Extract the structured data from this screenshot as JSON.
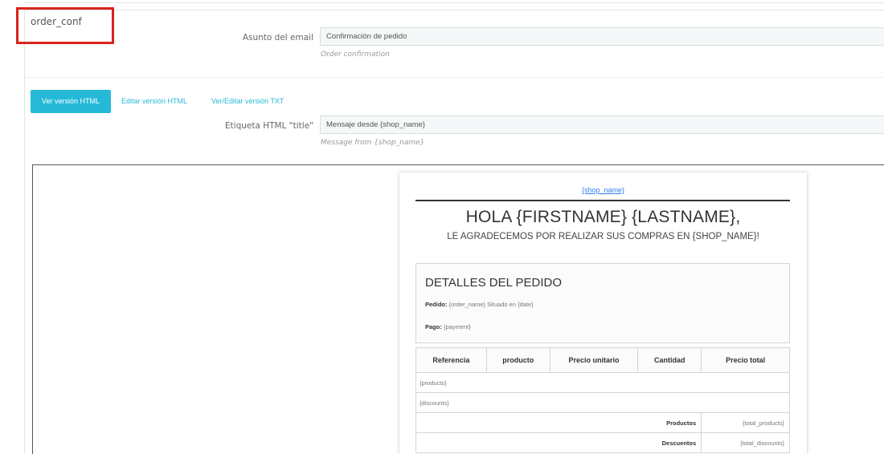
{
  "template": {
    "name": "order_conf"
  },
  "subject": {
    "label": "Asunto del email",
    "value": "Confirmación de pedido",
    "help": "Order confirmation"
  },
  "tabs": [
    {
      "label": "Ver versión HTML",
      "active": true
    },
    {
      "label": "Editar versión HTML",
      "active": false
    },
    {
      "label": "Ver/Editar versión TXT",
      "active": false
    }
  ],
  "title_tag": {
    "label": "Etiqueta HTML \"title\"",
    "value": "Mensaje desde {shop_name}",
    "help": "Message from {shop_name}"
  },
  "mail": {
    "shop_link": "{shop_name}",
    "greeting": "HOLA {FIRSTNAME} {LASTNAME},",
    "subtitle": "LE AGRADECEMOS POR REALIZAR SUS COMPRAS EN {SHOP_NAME}!",
    "details": {
      "title": "DETALLES DEL PEDIDO",
      "order_label": "Pedido:",
      "order_value": "{order_name} Situado en {date}",
      "payment_label": "Pago:",
      "payment_value": "{payment}"
    },
    "table": {
      "headers": [
        "Referencia",
        "producto",
        "Precio unitario",
        "Cantidad",
        "Precio total"
      ],
      "products": "{products}",
      "discounts": "{discounts}",
      "totals": [
        {
          "label": "Productos",
          "value": "{total_products}"
        },
        {
          "label": "Descuentos",
          "value": "{total_discounts}"
        }
      ]
    }
  },
  "colors": {
    "accent": "#25b9d7",
    "highlight": "#d9231d",
    "link": "#337ff1"
  }
}
